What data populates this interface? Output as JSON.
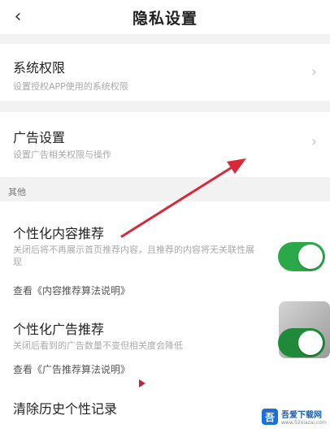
{
  "header": {
    "title": "隐私设置",
    "back_icon": "chevron-left-icon"
  },
  "system_permission": {
    "title": "系统权限",
    "subtitle": "设置授权APP使用的系统权限"
  },
  "ad_settings": {
    "title": "广告设置",
    "subtitle": "设置广告相关权限与操作"
  },
  "section_other": {
    "label": "其他"
  },
  "personalized_content": {
    "title": "个性化内容推荐",
    "description": "关闭后将不再展示首页推荐内容，且推荐的内容将无关联性展现",
    "link": "查看《内容推荐算法说明》",
    "toggle_on": true
  },
  "personalized_ads": {
    "title": "个性化广告推荐",
    "description": "关闭后看到的广告数量不变但相关度会降低",
    "link": "查看《广告推荐算法说明》",
    "toggle_on": true
  },
  "clear_history": {
    "title": "清除历史个性记录"
  },
  "watermark": {
    "logo": "吾",
    "name": "吾爱下载网",
    "url": "www.52xiazai.com"
  },
  "colors": {
    "toggle_on": "#2aa84a",
    "annotation_arrow": "#d8283a"
  }
}
